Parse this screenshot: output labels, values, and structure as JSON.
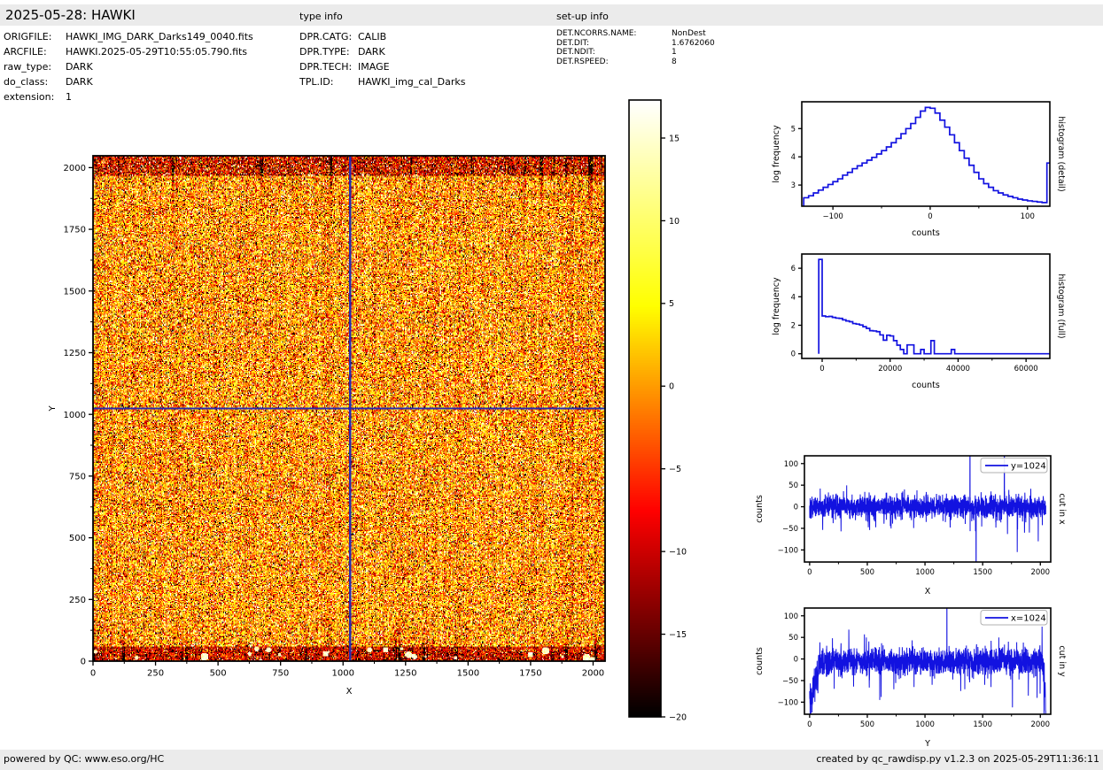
{
  "header": {
    "title": "2025-05-28: HAWKI",
    "type_info_label": "type info",
    "setup_info_label": "set-up info"
  },
  "meta": {
    "left": [
      {
        "label": "ORIGFILE:",
        "value": "HAWKI_IMG_DARK_Darks149_0040.fits"
      },
      {
        "label": "ARCFILE:",
        "value": "HAWKI.2025-05-29T10:55:05.790.fits"
      },
      {
        "label": "raw_type:",
        "value": "DARK"
      },
      {
        "label": "do_class:",
        "value": "DARK"
      },
      {
        "label": "extension:",
        "value": "1"
      }
    ],
    "type": [
      {
        "label": "DPR.CATG:",
        "value": "CALIB"
      },
      {
        "label": "DPR.TYPE:",
        "value": "DARK"
      },
      {
        "label": "DPR.TECH:",
        "value": "IMAGE"
      },
      {
        "label": "TPL.ID:",
        "value": "HAWKI_img_cal_Darks"
      }
    ],
    "setup": [
      {
        "label": "DET.NCORRS.NAME:",
        "value": "NonDest"
      },
      {
        "label": "DET.DIT:",
        "value": "1.6762060"
      },
      {
        "label": "DET.NDIT:",
        "value": "1"
      },
      {
        "label": "DET.RSPEED:",
        "value": "8"
      }
    ]
  },
  "footer": {
    "left": "powered by QC: www.eso.org/HC",
    "right": "created by qc_rawdisp.py v1.2.3 on 2025-05-29T11:36:11"
  },
  "colors": {
    "line_blue": "#1212e0",
    "crosshair_blue": "#2a2aad",
    "band_gray": "#ebebeb",
    "axes_black": "#000000"
  },
  "chart_data": [
    {
      "type": "heatmap",
      "name": "raw image display",
      "xlabel": "X",
      "ylabel": "Y",
      "x_ticks": [
        0,
        250,
        500,
        750,
        1000,
        1250,
        1500,
        1750,
        2000
      ],
      "y_ticks": [
        0,
        250,
        500,
        750,
        1000,
        1250,
        1500,
        1750,
        2000
      ],
      "extent": [
        0,
        2048,
        0,
        2048
      ],
      "colormap": "hot",
      "vmin": -20,
      "vmax": 17.3,
      "colorbar_ticks": [
        15,
        10,
        5,
        0,
        -5,
        -10,
        -15,
        -20
      ],
      "crosshair": {
        "x": 1024,
        "y": 1024
      },
      "noise": {
        "seed": 42,
        "body_mean": 1.5,
        "body_sigma": 7
      },
      "description": "2048x2048 dark frame: orange/red/yellow speckle noise with black and white outliers, dark speckled bands at top and bottom edges with white blobs and vertical dark streaks, blue crosshair cut lines at x=1024 and y=1024"
    },
    {
      "type": "step-histogram",
      "name": "histogram (detail)",
      "xlabel": "counts",
      "ylabel": "log frequency",
      "xlim": [
        -132,
        123
      ],
      "ylim": [
        2.25,
        5.95
      ],
      "x_ticks": [
        -100,
        0,
        100
      ],
      "x_minor_ticks": [
        -50,
        50
      ],
      "y_ticks": [
        3,
        4,
        5
      ],
      "bin_start": -130,
      "bin_width": 5,
      "baseline": 2.25,
      "values": [
        2.55,
        2.62,
        2.72,
        2.82,
        2.92,
        3.02,
        3.12,
        3.22,
        3.35,
        3.45,
        3.58,
        3.68,
        3.78,
        3.88,
        3.98,
        4.1,
        4.22,
        4.35,
        4.5,
        4.65,
        4.82,
        5.0,
        5.18,
        5.4,
        5.62,
        5.75,
        5.72,
        5.55,
        5.3,
        5.05,
        4.78,
        4.5,
        4.22,
        3.95,
        3.7,
        3.45,
        3.22,
        3.05,
        2.92,
        2.8,
        2.72,
        2.65,
        2.6,
        2.55,
        2.5,
        2.47,
        2.44,
        2.42,
        2.4,
        2.38,
        3.78
      ]
    },
    {
      "type": "step-histogram",
      "name": "histogram (full)",
      "xlabel": "counts",
      "ylabel": "log frequency",
      "xlim": [
        -6000,
        67000
      ],
      "ylim": [
        -0.33,
        7
      ],
      "x_ticks": [
        0,
        20000,
        40000,
        60000
      ],
      "x_minor_ticks": [
        10000,
        30000,
        50000
      ],
      "y_ticks": [
        0,
        2,
        4,
        6
      ],
      "bin_start": -1000,
      "bin_width": 1000,
      "baseline": 0,
      "values": [
        6.62,
        2.65,
        2.6,
        2.62,
        2.55,
        2.5,
        2.48,
        2.38,
        2.3,
        2.25,
        2.12,
        2.08,
        2.02,
        1.9,
        1.78,
        1.62,
        1.6,
        1.55,
        1.32,
        0.95,
        1.3,
        1.25,
        0.92,
        0.6,
        0.3,
        0,
        0.62,
        0.62,
        0,
        0,
        0.3,
        0,
        0,
        0.92,
        0,
        0,
        0,
        0,
        0,
        0.3,
        0
      ]
    },
    {
      "type": "line",
      "name": "cut in x",
      "legend_label": "y=1024",
      "xlabel": "X",
      "ylabel": "counts",
      "xlim": [
        -45,
        2090
      ],
      "ylim": [
        -128,
        118
      ],
      "x_ticks": [
        0,
        500,
        1000,
        1500,
        2000
      ],
      "x_minor_ticks": [
        250,
        750,
        1250,
        1750
      ],
      "y_ticks": [
        -100,
        -50,
        0,
        50,
        100
      ],
      "n_points": 2048,
      "noise": {
        "mean": 0,
        "sigma": 13,
        "seed": 101
      },
      "spikes": [
        [
          272,
          -57
        ],
        [
          520,
          -54
        ],
        [
          700,
          -45
        ],
        [
          822,
          40
        ],
        [
          930,
          38
        ],
        [
          1218,
          -48
        ],
        [
          1390,
          300
        ],
        [
          1443,
          -300
        ],
        [
          1688,
          300
        ],
        [
          1800,
          -105
        ],
        [
          1905,
          -60
        ],
        [
          1982,
          -80
        ]
      ]
    },
    {
      "type": "line",
      "name": "cut in y",
      "legend_label": "x=1024",
      "xlabel": "Y",
      "ylabel": "counts",
      "xlim": [
        -45,
        2090
      ],
      "ylim": [
        -128,
        118
      ],
      "x_ticks": [
        0,
        500,
        1000,
        1500,
        2000
      ],
      "x_minor_ticks": [
        250,
        750,
        1250,
        1750
      ],
      "y_ticks": [
        -100,
        -50,
        0,
        50,
        100
      ],
      "n_points": 2048,
      "noise": {
        "mean": -5,
        "sigma": 15,
        "seed": 202
      },
      "edge_dips": {
        "left_until": 85,
        "right_from": 2020
      },
      "spikes": [
        [
          198,
          48
        ],
        [
          340,
          68
        ],
        [
          475,
          57
        ],
        [
          492,
          50
        ],
        [
          608,
          -95
        ],
        [
          620,
          -88
        ],
        [
          730,
          -70
        ],
        [
          905,
          -65
        ],
        [
          1062,
          -60
        ],
        [
          1190,
          300
        ],
        [
          1345,
          -70
        ],
        [
          1518,
          -60
        ],
        [
          1640,
          50
        ],
        [
          1758,
          -112
        ],
        [
          1896,
          -85
        ],
        [
          1972,
          -90
        ],
        [
          2015,
          75
        ],
        [
          2032,
          -130
        ]
      ]
    }
  ]
}
